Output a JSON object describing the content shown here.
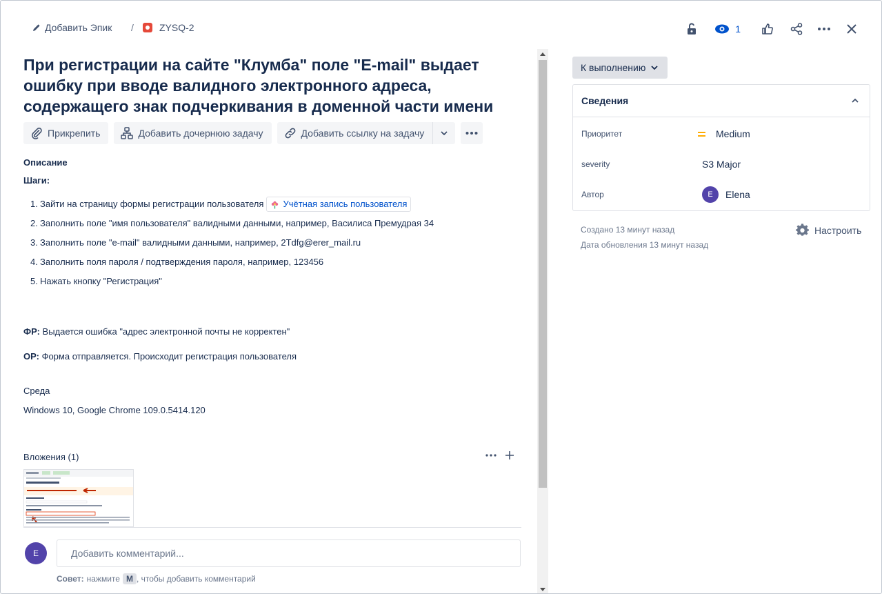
{
  "header": {
    "epic_label": "Добавить Эпик",
    "separator": "/",
    "issue_key": "ZYSQ-2",
    "watch_count": "1"
  },
  "issue": {
    "title": "При регистрации на сайте \"Клумба\" поле \"E-mail\" выдает ошибку при вводе валидного электронного адреса, содержащего знак подчеркивания в доменной части имени"
  },
  "actions": {
    "attach": "Прикрепить",
    "add_child": "Добавить дочернюю задачу",
    "add_link": "Добавить ссылку на задачу"
  },
  "description": {
    "label": "Описание",
    "steps_title": "Шаги:",
    "steps": [
      {
        "num": "1.",
        "text": "Зайти на страницу формы регистрации пользователя",
        "link": "Учётная запись пользователя"
      },
      {
        "num": "2.",
        "text": "Заполнить поле \"имя пользователя\" валидными данными, например, Василиса Премудрая 34"
      },
      {
        "num": "3.",
        "text": "Заполнить поле \"e-mail\" валидными данными, например, 2Tdfg@erer_mail.ru"
      },
      {
        "num": "4.",
        "text": "Заполнить поля пароля / подтверждения пароля, например, 123456"
      },
      {
        "num": "5.",
        "text": "Нажать кнопку \"Регистрация\""
      }
    ],
    "fr_label": "ФР:",
    "fr_text": " Выдается ошибка \"адрес электронной почты не корректен\"",
    "or_label": "ОР:",
    "or_text": " Форма отправляется. Происходит регистрация пользователя"
  },
  "environment": {
    "label": "Среда",
    "value": "Windows 10, Google Chrome 109.0.5414.120"
  },
  "attachments": {
    "label": "Вложения (1)"
  },
  "comment": {
    "avatar_letter": "E",
    "placeholder": "Добавить комментарий...",
    "tip_label": "Совет:",
    "tip_pre": " нажмите",
    "tip_key": "M",
    "tip_post": ", чтобы добавить комментарий"
  },
  "sidebar": {
    "status": "К выполнению",
    "details_title": "Сведения",
    "fields": {
      "priority_label": "Приоритет",
      "priority_value": "Medium",
      "severity_label": "severity",
      "severity_value": "S3 Major",
      "author_label": "Автор",
      "author_letter": "E",
      "author_value": "Elena"
    },
    "created": "Создано 13 минут назад",
    "updated": "Дата обновления 13 минут назад",
    "configure": "Настроить"
  },
  "colors": {
    "accent": "#0052cc",
    "bug": "#e5493a",
    "priority_medium": "#ffab00",
    "avatar": "#5243aa"
  }
}
